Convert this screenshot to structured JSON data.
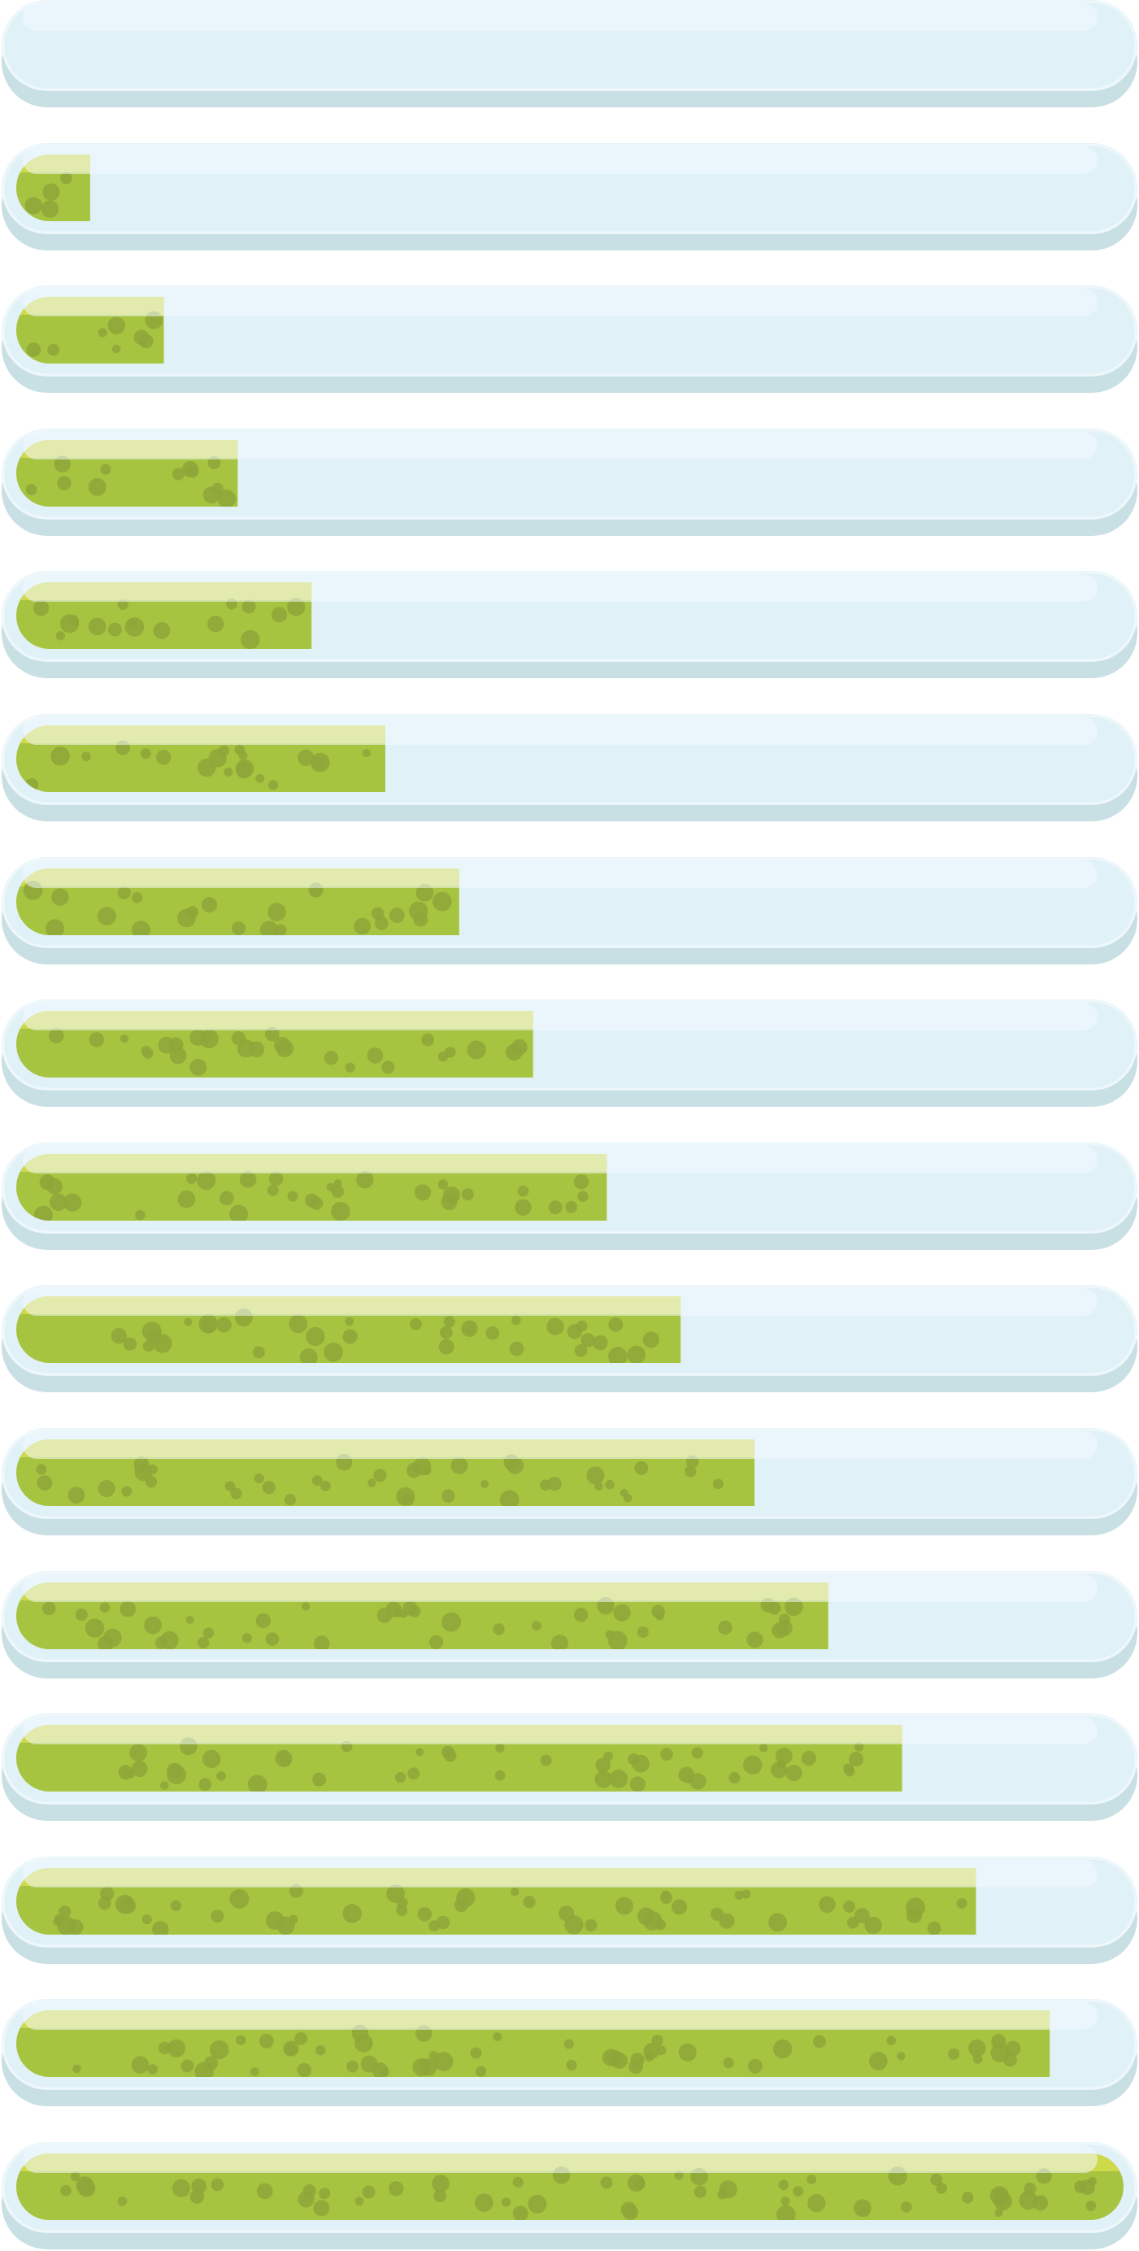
{
  "colors": {
    "tube_light": "#e1f1f8",
    "tube_shadow": "#c8dfe4",
    "tube_rim": "#eef8fb",
    "tube_highlight": "#f3fafd",
    "fill_green": "#a6c43f",
    "fill_highlight": "#cfd94c",
    "bubble": "#8ea63a"
  },
  "progress_bars": [
    {
      "progress": 0.0
    },
    {
      "progress": 0.0667
    },
    {
      "progress": 0.1333
    },
    {
      "progress": 0.2
    },
    {
      "progress": 0.2667
    },
    {
      "progress": 0.3333
    },
    {
      "progress": 0.4
    },
    {
      "progress": 0.4667
    },
    {
      "progress": 0.5333
    },
    {
      "progress": 0.6
    },
    {
      "progress": 0.6667
    },
    {
      "progress": 0.7333
    },
    {
      "progress": 0.8
    },
    {
      "progress": 0.8667
    },
    {
      "progress": 0.9333
    },
    {
      "progress": 1.0
    }
  ]
}
